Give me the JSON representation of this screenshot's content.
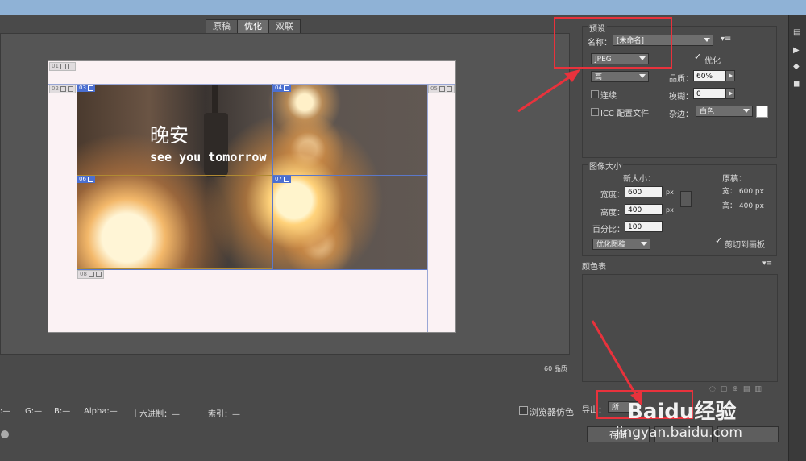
{
  "view_tabs": [
    "原稿",
    "优化",
    "双联"
  ],
  "slices": {
    "s01": "01",
    "s02": "02",
    "s03": "03",
    "s04": "04",
    "s05": "05",
    "s06": "06",
    "s07": "07",
    "s08": "08"
  },
  "image_text": {
    "line1": "晚安",
    "line2": "see you tomorrow"
  },
  "quality_note": "60 品质",
  "status": {
    "r": ":—",
    "g": "G:—",
    "b": "B:—",
    "alpha": "Alpha:—",
    "hex": "十六进制：—",
    "index": "索引：—"
  },
  "browser_dither_label": "浏览器仿色",
  "preset": {
    "section_title": "预设",
    "name_label": "名称：",
    "name_value": "[未命名]",
    "format_value": "JPEG",
    "optimize_label": "优化",
    "optimize_checked": true,
    "quality_preset_value": "高",
    "quality_label": "品质：",
    "quality_value": "60%",
    "progressive_label": "连续",
    "blur_label": "模糊：",
    "blur_value": "0",
    "icc_label": "ICC 配置文件",
    "matte_label": "杂边：",
    "matte_value": "白色",
    "matte_color": "#ffffff"
  },
  "image_size": {
    "section_title": "图像大小",
    "new_size_label": "新大小：",
    "width_label": "宽度：",
    "width_value": "600",
    "height_label": "高度：",
    "height_value": "400",
    "unit": "px",
    "percent_label": "百分比：",
    "percent_value": "100",
    "resample_value": "优化图稿",
    "original_label": "原稿：",
    "orig_width": "宽：  600 px",
    "orig_height": "高：  400 px",
    "clip_label": "剪切到画板",
    "clip_checked": true
  },
  "color_table": {
    "title": "颜色表"
  },
  "export": {
    "label": "导出：",
    "value": "所"
  },
  "buttons": {
    "save": "存储"
  },
  "watermark": {
    "logo": "Baidu经验",
    "url": "jingyan.baidu.com"
  },
  "accent_colors": {
    "highlight": "#e8323c",
    "slice": "#5b78c9"
  }
}
